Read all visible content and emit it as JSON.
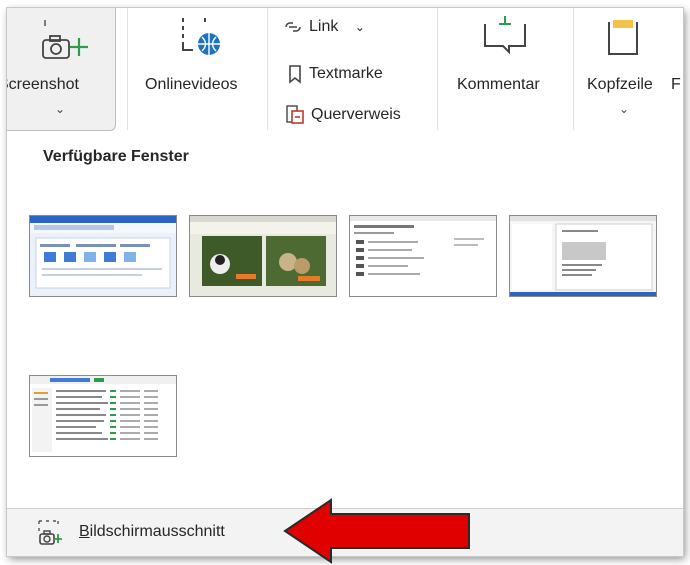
{
  "ribbon": {
    "screenshot_label": "Screenshot",
    "onlinevideos_label": "Onlinevideos",
    "link_label": "Link",
    "textmarke_label": "Textmarke",
    "querverweis_label": "Querverweis",
    "kommentar_label": "Kommentar",
    "kopfzeile_label": "Kopfzeile",
    "next_cut_label": "F"
  },
  "gallery": {
    "title": "Verfügbare Fenster",
    "windows": [
      "window-1",
      "window-2",
      "window-3",
      "window-4",
      "window-5"
    ]
  },
  "footer": {
    "clip_first_letter": "B",
    "clip_rest": "ildschirmausschnitt"
  },
  "colors": {
    "accent_green": "#2e9c4b",
    "accent_blue": "#1e73be",
    "arrow_red": "#e00000"
  }
}
